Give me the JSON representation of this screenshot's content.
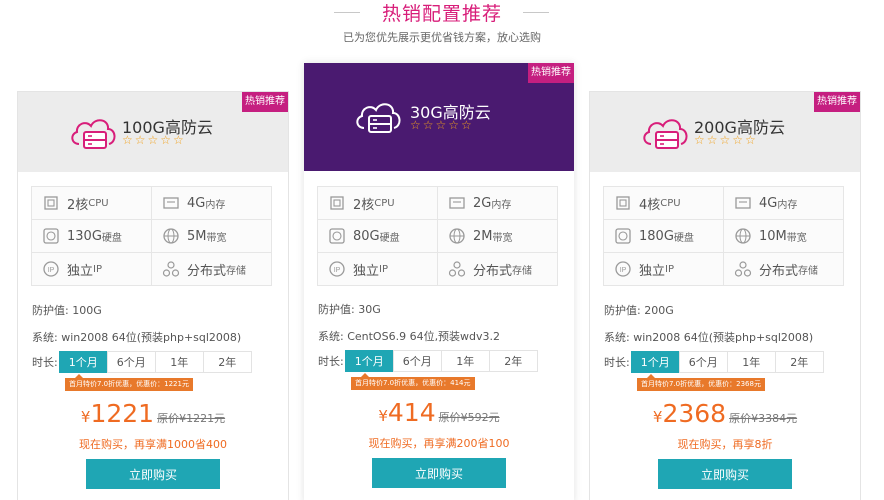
{
  "header": {
    "title": "热销配置推荐",
    "subtitle": "已为您优先展示更优省钱方案，放心选购"
  },
  "colors": {
    "accent_pink": "#d81e7a",
    "featured_bg": "#4a1a70",
    "teal": "#1fa6b4",
    "orange": "#ef6b22"
  },
  "cards": [
    {
      "badge": "热销推荐",
      "name": "100G高防云",
      "stars": "☆☆☆☆☆",
      "specs": [
        {
          "icon": "cpu-icon",
          "value": "2核",
          "unit": "CPU"
        },
        {
          "icon": "memory-icon",
          "value": "4G",
          "unit": "内存"
        },
        {
          "icon": "disk-icon",
          "value": "130G",
          "unit": "硬盘"
        },
        {
          "icon": "globe-icon",
          "value": "5M",
          "unit": "带宽"
        },
        {
          "icon": "ip-icon",
          "value": "独立",
          "unit": "IP"
        },
        {
          "icon": "distributed-icon",
          "value": "分布式",
          "unit": "存储"
        }
      ],
      "protect": "防护值:   100G",
      "system": "系统:   win2008 64位(预装php+sql2008)",
      "duration_label": "时长:",
      "durations": [
        "1个月",
        "6个月",
        "1年",
        "2年"
      ],
      "promo": "首月特价7.0折优惠，优惠价：1221元",
      "currency": "¥",
      "price": "1221",
      "original": "原价¥1221元",
      "deal": "现在购买，再享满1000省400",
      "buy": "立即购买"
    },
    {
      "badge": "热销推荐",
      "name": "30G高防云",
      "stars": "☆☆☆☆☆",
      "specs": [
        {
          "icon": "cpu-icon",
          "value": "2核",
          "unit": "CPU"
        },
        {
          "icon": "memory-icon",
          "value": "2G",
          "unit": "内存"
        },
        {
          "icon": "disk-icon",
          "value": "80G",
          "unit": "硬盘"
        },
        {
          "icon": "globe-icon",
          "value": "2M",
          "unit": "带宽"
        },
        {
          "icon": "ip-icon",
          "value": "独立",
          "unit": "IP"
        },
        {
          "icon": "distributed-icon",
          "value": "分布式",
          "unit": "存储"
        }
      ],
      "protect": "防护值:   30G",
      "system": "系统:   CentOS6.9 64位,预装wdv3.2",
      "duration_label": "时长:",
      "durations": [
        "1个月",
        "6个月",
        "1年",
        "2年"
      ],
      "promo": "首月特价7.0折优惠，优惠价：414元",
      "currency": "¥",
      "price": "414",
      "original": "原价¥592元",
      "deal": "现在购买，再享满200省100",
      "buy": "立即购买"
    },
    {
      "badge": "热销推荐",
      "name": "200G高防云",
      "stars": "☆☆☆☆☆",
      "specs": [
        {
          "icon": "cpu-icon",
          "value": "4核",
          "unit": "CPU"
        },
        {
          "icon": "memory-icon",
          "value": "4G",
          "unit": "内存"
        },
        {
          "icon": "disk-icon",
          "value": "180G",
          "unit": "硬盘"
        },
        {
          "icon": "globe-icon",
          "value": "10M",
          "unit": "带宽"
        },
        {
          "icon": "ip-icon",
          "value": "独立",
          "unit": "IP"
        },
        {
          "icon": "distributed-icon",
          "value": "分布式",
          "unit": "存储"
        }
      ],
      "protect": "防护值:   200G",
      "system": "系统:   win2008 64位(预装php+sql2008)",
      "duration_label": "时长:",
      "durations": [
        "1个月",
        "6个月",
        "1年",
        "2年"
      ],
      "promo": "首月特价7.0折优惠，优惠价：2368元",
      "currency": "¥",
      "price": "2368",
      "original": "原价¥3384元",
      "deal": "现在购买，再享8折",
      "buy": "立即购买"
    }
  ]
}
